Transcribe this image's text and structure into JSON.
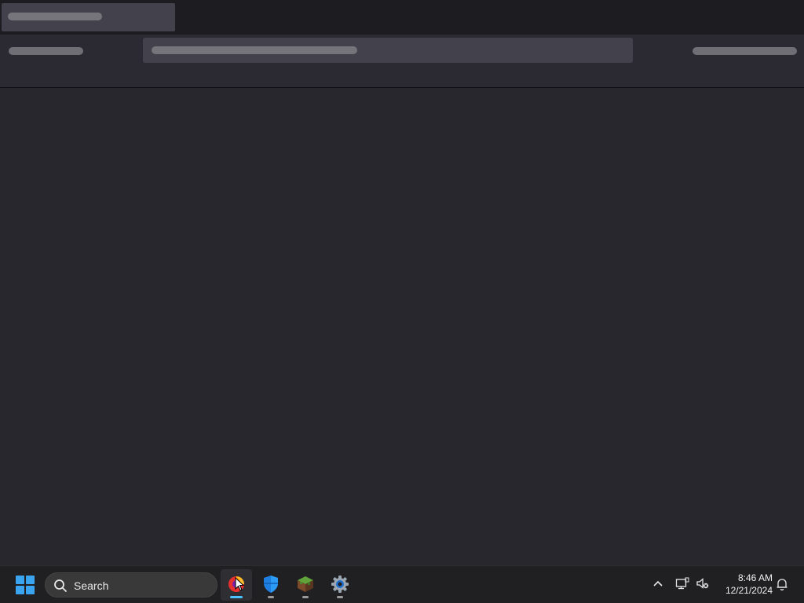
{
  "taskbar": {
    "search_label": "Search",
    "apps": [
      {
        "name": "firefox-icon",
        "active": true
      },
      {
        "name": "defender-icon",
        "active": false
      },
      {
        "name": "minecraft-icon",
        "active": false
      },
      {
        "name": "settings-icon",
        "active": false
      }
    ],
    "tray": {
      "chevron": "^",
      "time": "8:46 AM",
      "date": "12/21/2024"
    }
  },
  "colors": {
    "accent": "#4cc2ff",
    "windows_blue": "#3ba4f0",
    "page_bg": "#28272d",
    "toolbar_bg": "#2b2a33"
  }
}
